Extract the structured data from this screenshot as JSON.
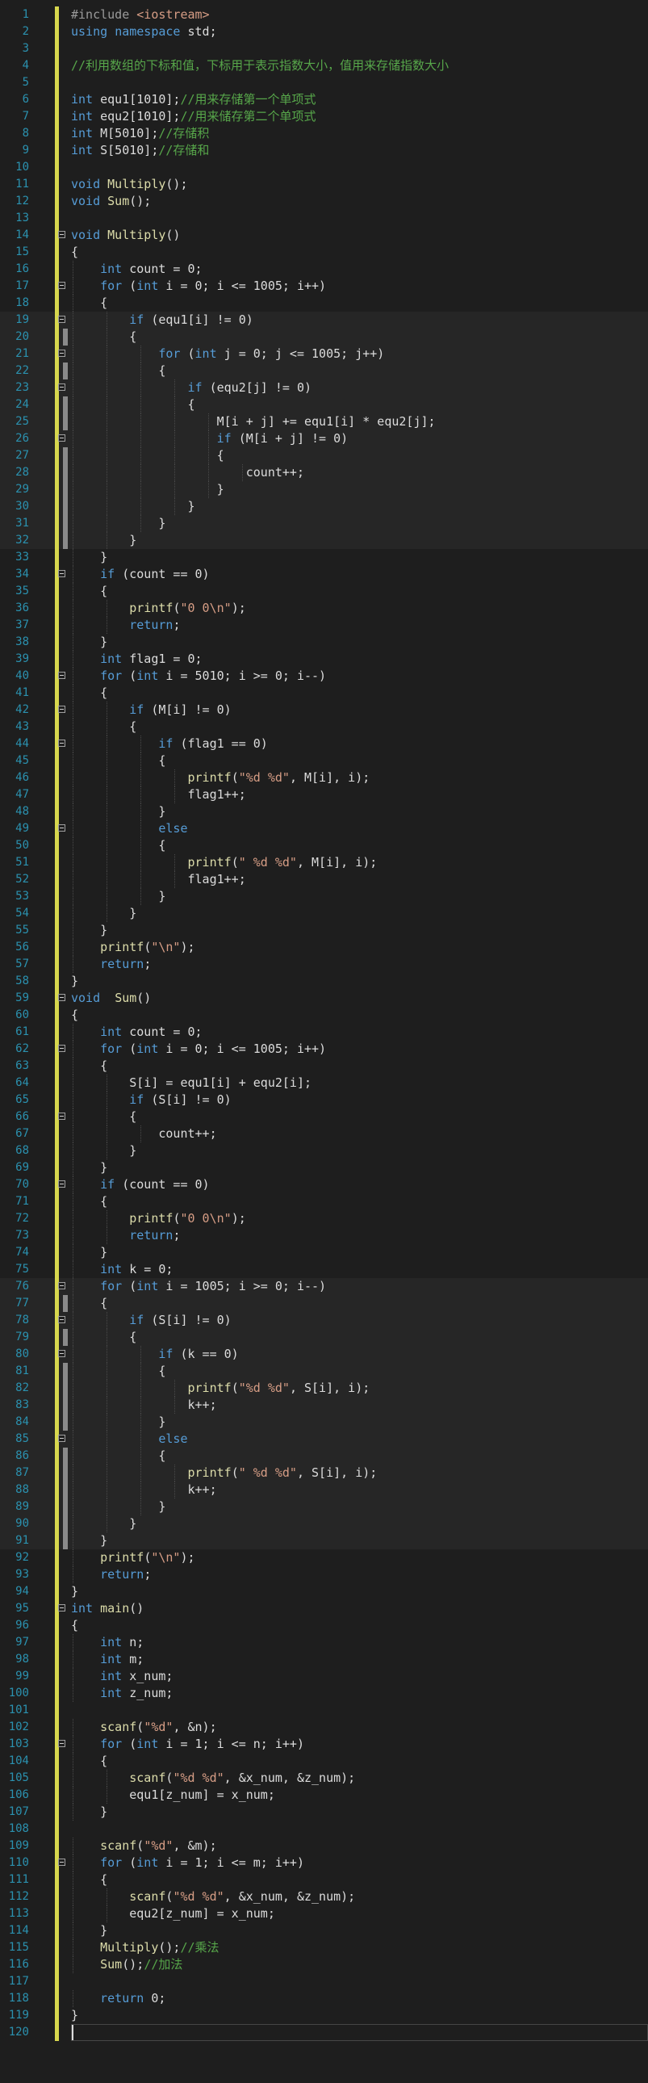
{
  "editor": {
    "language": "C++",
    "cursor_line": 120,
    "lines": [
      "#include <iostream>",
      "using namespace std;",
      "",
      "//利用数组的下标和值，下标用于表示指数大小，值用来存储指数大小",
      "",
      "int equ1[1010];//用来存储第一个单项式",
      "int equ2[1010];//用来储存第二个单项式",
      "int M[5010];//存储积",
      "int S[5010];//存储和",
      "",
      "void Multiply();",
      "void Sum();",
      "",
      "void Multiply()",
      "{",
      "    int count = 0;",
      "    for (int i = 0; i <= 1005; i++)",
      "    {",
      "        if (equ1[i] != 0)",
      "        {",
      "            for (int j = 0; j <= 1005; j++)",
      "            {",
      "                if (equ2[j] != 0)",
      "                {",
      "                    M[i + j] += equ1[i] * equ2[j];",
      "                    if (M[i + j] != 0)",
      "                    {",
      "                        count++;",
      "                    }",
      "                }",
      "            }",
      "        }",
      "    }",
      "    if (count == 0)",
      "    {",
      "        printf(\"0 0\\n\");",
      "        return;",
      "    }",
      "    int flag1 = 0;",
      "    for (int i = 5010; i >= 0; i--)",
      "    {",
      "        if (M[i] != 0)",
      "        {",
      "            if (flag1 == 0)",
      "            {",
      "                printf(\"%d %d\", M[i], i);",
      "                flag1++;",
      "            }",
      "            else",
      "            {",
      "                printf(\" %d %d\", M[i], i);",
      "                flag1++;",
      "            }",
      "        }",
      "    }",
      "    printf(\"\\n\");",
      "    return;",
      "}",
      "void  Sum()",
      "{",
      "    int count = 0;",
      "    for (int i = 0; i <= 1005; i++)",
      "    {",
      "        S[i] = equ1[i] + equ2[i];",
      "        if (S[i] != 0)",
      "        {",
      "            count++;",
      "        }",
      "    }",
      "    if (count == 0)",
      "    {",
      "        printf(\"0 0\\n\");",
      "        return;",
      "    }",
      "    int k = 0;",
      "    for (int i = 1005; i >= 0; i--)",
      "    {",
      "        if (S[i] != 0)",
      "        {",
      "            if (k == 0)",
      "            {",
      "                printf(\"%d %d\", S[i], i);",
      "                k++;",
      "            }",
      "            else",
      "            {",
      "                printf(\" %d %d\", S[i], i);",
      "                k++;",
      "            }",
      "        }",
      "    }",
      "    printf(\"\\n\");",
      "    return;",
      "}",
      "int main()",
      "{",
      "    int n;",
      "    int m;",
      "    int x_num;",
      "    int z_num;",
      "",
      "    scanf(\"%d\", &n);",
      "    for (int i = 1; i <= n; i++)",
      "    {",
      "        scanf(\"%d %d\", &x_num, &z_num);",
      "        equ1[z_num] = x_num;",
      "    }",
      "",
      "    scanf(\"%d\", &m);",
      "    for (int i = 1; i <= m; i++)",
      "    {",
      "        scanf(\"%d %d\", &x_num, &z_num);",
      "        equ2[z_num] = x_num;",
      "    }",
      "    Multiply();//乘法",
      "    Sum();//加法",
      "",
      "    return 0;",
      "}",
      ""
    ],
    "fold_lines": [
      14,
      17,
      19,
      21,
      23,
      26,
      34,
      40,
      42,
      44,
      49,
      59,
      62,
      66,
      70,
      76,
      78,
      80,
      85,
      95,
      103,
      110
    ],
    "highlight_ranges": [
      [
        19,
        32
      ],
      [
        76,
        91
      ]
    ],
    "colors": {
      "background": "#1e1e1e",
      "line_number": "#2b91af",
      "keyword": "#569cd6",
      "function": "#dcdcaa",
      "string": "#d69d85",
      "comment": "#57a64a",
      "change_marker": "#d7d74d"
    }
  }
}
